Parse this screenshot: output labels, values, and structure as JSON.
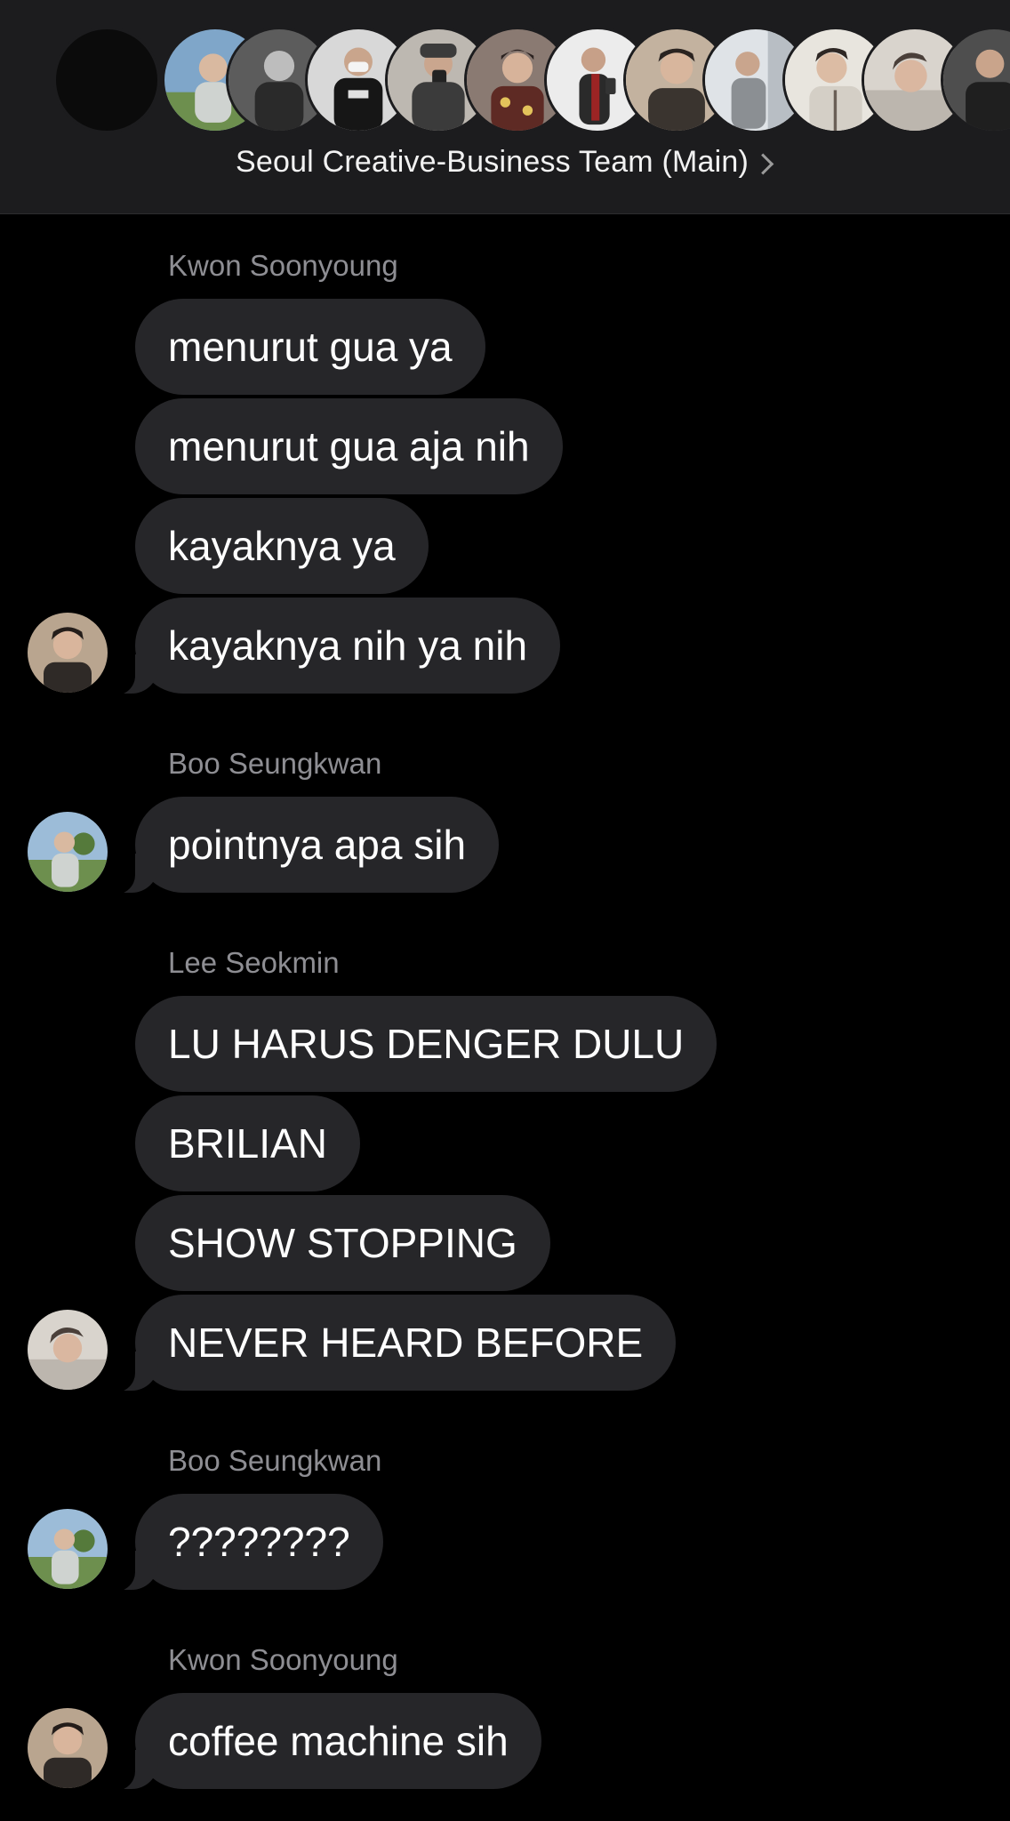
{
  "header": {
    "title": "Seoul Creative-Business Team (Main)",
    "members": [
      {
        "icon": "group-avatar-placeholder",
        "bg": "#0b0b0b"
      },
      {
        "icon": "member-photo-outdoor-green",
        "bg": "#7fa6c9",
        "accent": "#6d8f4e"
      },
      {
        "icon": "member-photo-monochrome",
        "bg": "#5c5c5c",
        "accent": "#2a2a2a"
      },
      {
        "icon": "member-photo-black-shirt-mask",
        "bg": "#d8d8d8",
        "accent": "#161616"
      },
      {
        "icon": "member-photo-mirror-selfie",
        "bg": "#bdb8b1",
        "accent": "#3b3b3b"
      },
      {
        "icon": "member-photo-floral-shirt",
        "bg": "#8a7a72",
        "accent": "#5e2a24"
      },
      {
        "icon": "member-photo-phone-red-scarf",
        "bg": "#ececec",
        "accent": "#9c2424"
      },
      {
        "icon": "member-photo-dark-jacket",
        "bg": "#c3b29f",
        "accent": "#3a342f"
      },
      {
        "icon": "member-photo-pale-room",
        "bg": "#dfe3e7",
        "accent": "#8b8f93"
      },
      {
        "icon": "member-photo-light-shirt",
        "bg": "#e8e5de",
        "accent": "#6a5f56"
      },
      {
        "icon": "member-photo-lying-down",
        "bg": "#d9d4cd",
        "accent": "#4a3f39"
      },
      {
        "icon": "member-photo-dark-outfit",
        "bg": "#4e4e4e",
        "accent": "#1f1f1f"
      }
    ]
  },
  "messages": [
    {
      "sender": "Kwon Soonyoung",
      "avatar": "kwon-avatar",
      "lines": [
        "menurut gua ya",
        "menurut gua aja nih",
        "kayaknya ya",
        "kayaknya nih ya nih"
      ]
    },
    {
      "sender": "Boo Seungkwan",
      "avatar": "boo-avatar",
      "lines": [
        "pointnya apa sih"
      ]
    },
    {
      "sender": "Lee Seokmin",
      "avatar": "lee-avatar",
      "lines": [
        "LU HARUS DENGER DULU",
        "BRILIAN",
        "SHOW STOPPING",
        "NEVER HEARD BEFORE"
      ]
    },
    {
      "sender": "Boo Seungkwan",
      "avatar": "boo-avatar",
      "lines": [
        "????????"
      ]
    },
    {
      "sender": "Kwon Soonyoung",
      "avatar": "kwon-avatar",
      "lines": [
        "coffee machine sih"
      ]
    }
  ],
  "colors": {
    "background": "#000000",
    "header_bg": "#1c1c1e",
    "bubble": "#262629",
    "sender_name": "#8e8e93",
    "text": "#ffffff"
  }
}
